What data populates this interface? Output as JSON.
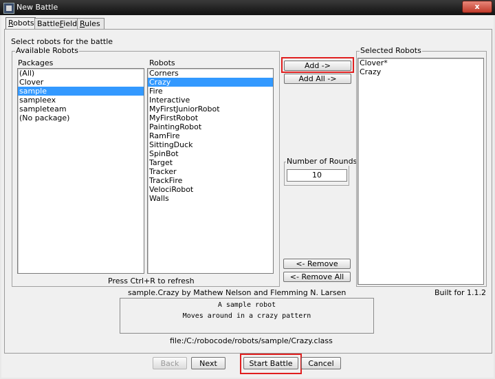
{
  "window": {
    "title": "New Battle",
    "close_label": "x"
  },
  "tabs": [
    {
      "label_ul": "R",
      "label_rest": "obots",
      "active": true
    },
    {
      "label_pre": "Battle",
      "label_ul": "F",
      "label_rest": "ield",
      "active": false
    },
    {
      "label_ul": "R",
      "label_rest": "ules",
      "active": false
    }
  ],
  "instructions": "Select robots for the battle",
  "available": {
    "group_title": "Available Robots",
    "packages_header": "Packages",
    "packages": [
      "(All)",
      "Clover",
      "sample",
      "sampleex",
      "sampleteam",
      "(No package)"
    ],
    "packages_selected": 2,
    "robots_header": "Robots",
    "robots": [
      "Corners",
      "Crazy",
      "Fire",
      "Interactive",
      "MyFirstJuniorRobot",
      "MyFirstRobot",
      "PaintingRobot",
      "RamFire",
      "SittingDuck",
      "SpinBot",
      "Target",
      "Tracker",
      "TrackFire",
      "VelociRobot",
      "Walls"
    ],
    "robots_selected": 1,
    "refresh_hint": "Press Ctrl+R to refresh"
  },
  "buttons": {
    "add": "Add ->",
    "add_all": "Add All ->",
    "remove": "<- Remove",
    "remove_all": "<- Remove All",
    "back": "Back",
    "next": "Next",
    "start": "Start Battle",
    "cancel": "Cancel"
  },
  "rounds": {
    "label": "Number of Rounds",
    "value": "10"
  },
  "selected": {
    "group_title": "Selected Robots",
    "items": [
      "Clover*",
      "Crazy"
    ]
  },
  "info": {
    "robot_author": "sample.Crazy by Mathew Nelson and Flemming N. Larsen",
    "built_for": "Built for 1.1.2",
    "description_lines": [
      "A sample robot",
      "Moves around in a crazy pattern"
    ],
    "file_path": "file:/C:/robocode/robots/sample/Crazy.class"
  },
  "colors": {
    "selection": "#3399ff",
    "highlight": "#e01e1e"
  }
}
